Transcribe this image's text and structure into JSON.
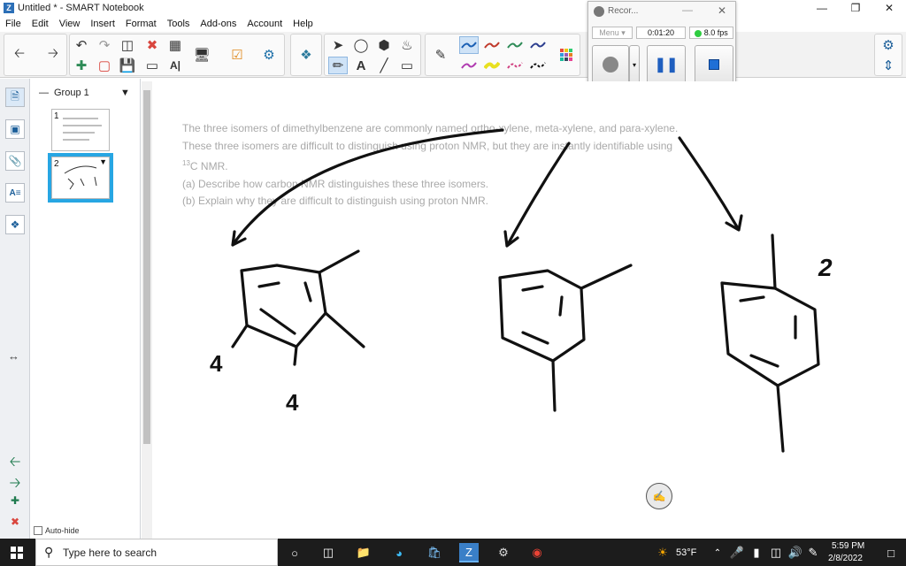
{
  "window": {
    "title": "Untitled * - SMART Notebook",
    "app_icon": "Z"
  },
  "menu": [
    "File",
    "Edit",
    "View",
    "Insert",
    "Format",
    "Tools",
    "Add-ons",
    "Account",
    "Help"
  ],
  "page_sorter": {
    "group_label": "Group 1",
    "pages": [
      {
        "num": "1"
      },
      {
        "num": "2"
      }
    ],
    "autohide_label": "Auto-hide"
  },
  "question": {
    "line1": "The three isomers of dimethylbenzene are commonly named ortho-xylene, meta-xylene, and para-xylene.",
    "line2": "These three isomers are difficult to distinguish using proton NMR, but they are instantly identifiable using",
    "line3_sup": "13",
    "line3": "C NMR.",
    "line4": "(a) Describe how carbon NMR distinguishes these three isomers.",
    "line5": "(b) Explain why they are difficult to distinguish using proton NMR."
  },
  "annotations": {
    "ortho_mark1": "4",
    "ortho_mark2": "4",
    "para_mark": "2"
  },
  "recorder": {
    "title": "Recor...",
    "dropdown": "Menu",
    "elapsed": "0:01:20",
    "fps": "8.0 fps"
  },
  "taskbar": {
    "search_placeholder": "Type here to search",
    "weather": "53°F",
    "time": "5:59 PM",
    "date": "2/8/2022"
  },
  "colors": {
    "accent_blue": "#27a6e3",
    "pen_colors": [
      "#1a5fb4",
      "#c0392b",
      "#2e8b57",
      "#2c3e8f",
      "#b03ab0",
      "#e8e020",
      "#d04080",
      "#111111"
    ]
  }
}
